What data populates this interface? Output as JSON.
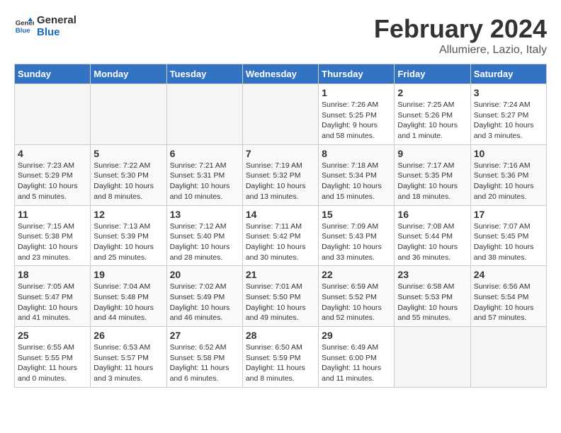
{
  "logo": {
    "line1": "General",
    "line2": "Blue"
  },
  "title": "February 2024",
  "subtitle": "Allumiere, Lazio, Italy",
  "days_of_week": [
    "Sunday",
    "Monday",
    "Tuesday",
    "Wednesday",
    "Thursday",
    "Friday",
    "Saturday"
  ],
  "weeks": [
    [
      {
        "day": "",
        "info": ""
      },
      {
        "day": "",
        "info": ""
      },
      {
        "day": "",
        "info": ""
      },
      {
        "day": "",
        "info": ""
      },
      {
        "day": "1",
        "info": "Sunrise: 7:26 AM\nSunset: 5:25 PM\nDaylight: 9 hours and 58 minutes."
      },
      {
        "day": "2",
        "info": "Sunrise: 7:25 AM\nSunset: 5:26 PM\nDaylight: 10 hours and 1 minute."
      },
      {
        "day": "3",
        "info": "Sunrise: 7:24 AM\nSunset: 5:27 PM\nDaylight: 10 hours and 3 minutes."
      }
    ],
    [
      {
        "day": "4",
        "info": "Sunrise: 7:23 AM\nSunset: 5:29 PM\nDaylight: 10 hours and 5 minutes."
      },
      {
        "day": "5",
        "info": "Sunrise: 7:22 AM\nSunset: 5:30 PM\nDaylight: 10 hours and 8 minutes."
      },
      {
        "day": "6",
        "info": "Sunrise: 7:21 AM\nSunset: 5:31 PM\nDaylight: 10 hours and 10 minutes."
      },
      {
        "day": "7",
        "info": "Sunrise: 7:19 AM\nSunset: 5:32 PM\nDaylight: 10 hours and 13 minutes."
      },
      {
        "day": "8",
        "info": "Sunrise: 7:18 AM\nSunset: 5:34 PM\nDaylight: 10 hours and 15 minutes."
      },
      {
        "day": "9",
        "info": "Sunrise: 7:17 AM\nSunset: 5:35 PM\nDaylight: 10 hours and 18 minutes."
      },
      {
        "day": "10",
        "info": "Sunrise: 7:16 AM\nSunset: 5:36 PM\nDaylight: 10 hours and 20 minutes."
      }
    ],
    [
      {
        "day": "11",
        "info": "Sunrise: 7:15 AM\nSunset: 5:38 PM\nDaylight: 10 hours and 23 minutes."
      },
      {
        "day": "12",
        "info": "Sunrise: 7:13 AM\nSunset: 5:39 PM\nDaylight: 10 hours and 25 minutes."
      },
      {
        "day": "13",
        "info": "Sunrise: 7:12 AM\nSunset: 5:40 PM\nDaylight: 10 hours and 28 minutes."
      },
      {
        "day": "14",
        "info": "Sunrise: 7:11 AM\nSunset: 5:42 PM\nDaylight: 10 hours and 30 minutes."
      },
      {
        "day": "15",
        "info": "Sunrise: 7:09 AM\nSunset: 5:43 PM\nDaylight: 10 hours and 33 minutes."
      },
      {
        "day": "16",
        "info": "Sunrise: 7:08 AM\nSunset: 5:44 PM\nDaylight: 10 hours and 36 minutes."
      },
      {
        "day": "17",
        "info": "Sunrise: 7:07 AM\nSunset: 5:45 PM\nDaylight: 10 hours and 38 minutes."
      }
    ],
    [
      {
        "day": "18",
        "info": "Sunrise: 7:05 AM\nSunset: 5:47 PM\nDaylight: 10 hours and 41 minutes."
      },
      {
        "day": "19",
        "info": "Sunrise: 7:04 AM\nSunset: 5:48 PM\nDaylight: 10 hours and 44 minutes."
      },
      {
        "day": "20",
        "info": "Sunrise: 7:02 AM\nSunset: 5:49 PM\nDaylight: 10 hours and 46 minutes."
      },
      {
        "day": "21",
        "info": "Sunrise: 7:01 AM\nSunset: 5:50 PM\nDaylight: 10 hours and 49 minutes."
      },
      {
        "day": "22",
        "info": "Sunrise: 6:59 AM\nSunset: 5:52 PM\nDaylight: 10 hours and 52 minutes."
      },
      {
        "day": "23",
        "info": "Sunrise: 6:58 AM\nSunset: 5:53 PM\nDaylight: 10 hours and 55 minutes."
      },
      {
        "day": "24",
        "info": "Sunrise: 6:56 AM\nSunset: 5:54 PM\nDaylight: 10 hours and 57 minutes."
      }
    ],
    [
      {
        "day": "25",
        "info": "Sunrise: 6:55 AM\nSunset: 5:55 PM\nDaylight: 11 hours and 0 minutes."
      },
      {
        "day": "26",
        "info": "Sunrise: 6:53 AM\nSunset: 5:57 PM\nDaylight: 11 hours and 3 minutes."
      },
      {
        "day": "27",
        "info": "Sunrise: 6:52 AM\nSunset: 5:58 PM\nDaylight: 11 hours and 6 minutes."
      },
      {
        "day": "28",
        "info": "Sunrise: 6:50 AM\nSunset: 5:59 PM\nDaylight: 11 hours and 8 minutes."
      },
      {
        "day": "29",
        "info": "Sunrise: 6:49 AM\nSunset: 6:00 PM\nDaylight: 11 hours and 11 minutes."
      },
      {
        "day": "",
        "info": ""
      },
      {
        "day": "",
        "info": ""
      }
    ]
  ]
}
